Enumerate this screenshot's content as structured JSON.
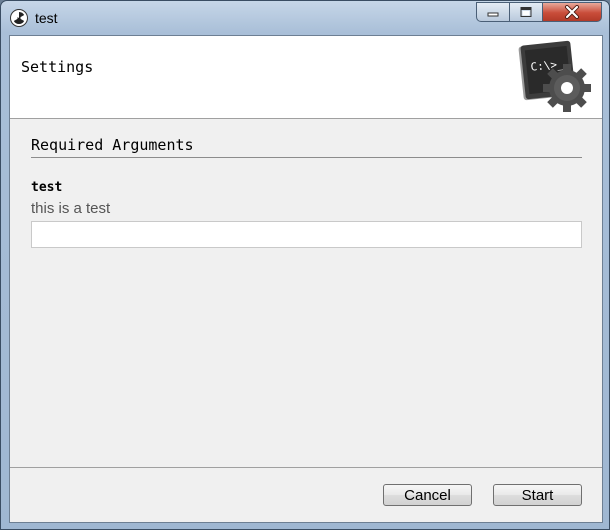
{
  "window": {
    "title": "test",
    "controls": {
      "minimize": "minimize-icon",
      "maximize": "maximize-icon",
      "close": "close-icon"
    }
  },
  "header": {
    "title": "Settings",
    "icon": {
      "name": "console-gear-icon",
      "text": "C:\\>_"
    }
  },
  "section": {
    "title": "Required Arguments",
    "arguments": [
      {
        "name": "test",
        "help": "this is a test",
        "value": "",
        "placeholder": ""
      }
    ]
  },
  "footer": {
    "cancel_label": "Cancel",
    "start_label": "Start"
  },
  "colors": {
    "close_button": "#c94d3a",
    "client_background": "#f0f0f0",
    "header_background": "#ffffff"
  }
}
